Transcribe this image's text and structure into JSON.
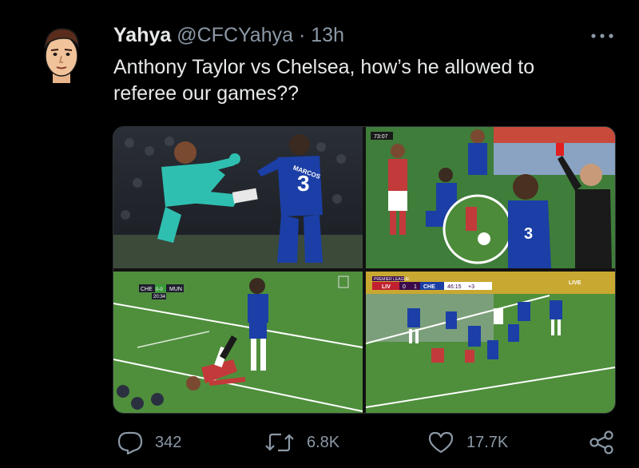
{
  "tweet": {
    "display_name": "Yahya",
    "handle": "@CFCYahya",
    "separator": "·",
    "time": "13h",
    "text_line1": "Anthony Taylor vs Chelsea, how’s he allowed to",
    "text_line2": "referee our games??"
  },
  "media": {
    "images": [
      {
        "icon": "goalkeeper-collision-photo",
        "shirt_text": "MARCOS",
        "shirt_number": "3"
      },
      {
        "icon": "referee-red-card-photo",
        "scoreboard": "73:07"
      },
      {
        "icon": "tackle-photo",
        "scoreboard": {
          "home": "CHE",
          "score": "0-0",
          "away": "MUN",
          "clock": "20:34"
        }
      },
      {
        "icon": "penalty-area-photo",
        "scoreboard": {
          "league": "PREMIER LEAGUE",
          "home": "LIV",
          "home_score": "0",
          "away_score": "1",
          "away": "CHE",
          "clock": "46:15",
          "added": "+3"
        },
        "badge": "LIVE"
      }
    ]
  },
  "actions": {
    "replies": "342",
    "retweets": "6.8K",
    "likes": "17.7K"
  },
  "colors": {
    "background": "#000000",
    "text_primary": "#e7e9ea",
    "text_secondary": "#8b98a5",
    "chelsea_blue": "#1b3fa6",
    "pitch_green": "#4c8b3a"
  }
}
